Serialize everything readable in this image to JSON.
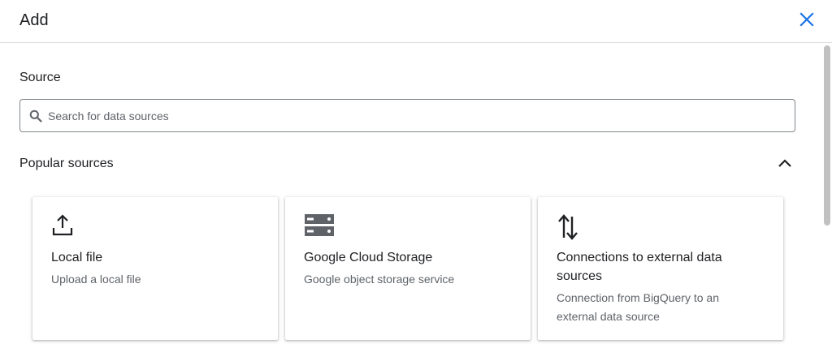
{
  "header": {
    "title": "Add"
  },
  "source": {
    "label": "Source",
    "search_placeholder": "Search for data sources"
  },
  "popular": {
    "label": "Popular sources",
    "cards": [
      {
        "title": "Local file",
        "description": "Upload a local file",
        "icon": "upload-icon"
      },
      {
        "title": "Google Cloud Storage",
        "description": "Google object storage service",
        "icon": "storage-icon"
      },
      {
        "title": "Connections to external data sources",
        "description": "Connection from BigQuery to an external data source",
        "icon": "swap-vert-icon"
      }
    ]
  },
  "colors": {
    "accent": "#1a73e8",
    "text": "#202124",
    "secondary_text": "#5f6368",
    "divider": "#dadce0"
  }
}
